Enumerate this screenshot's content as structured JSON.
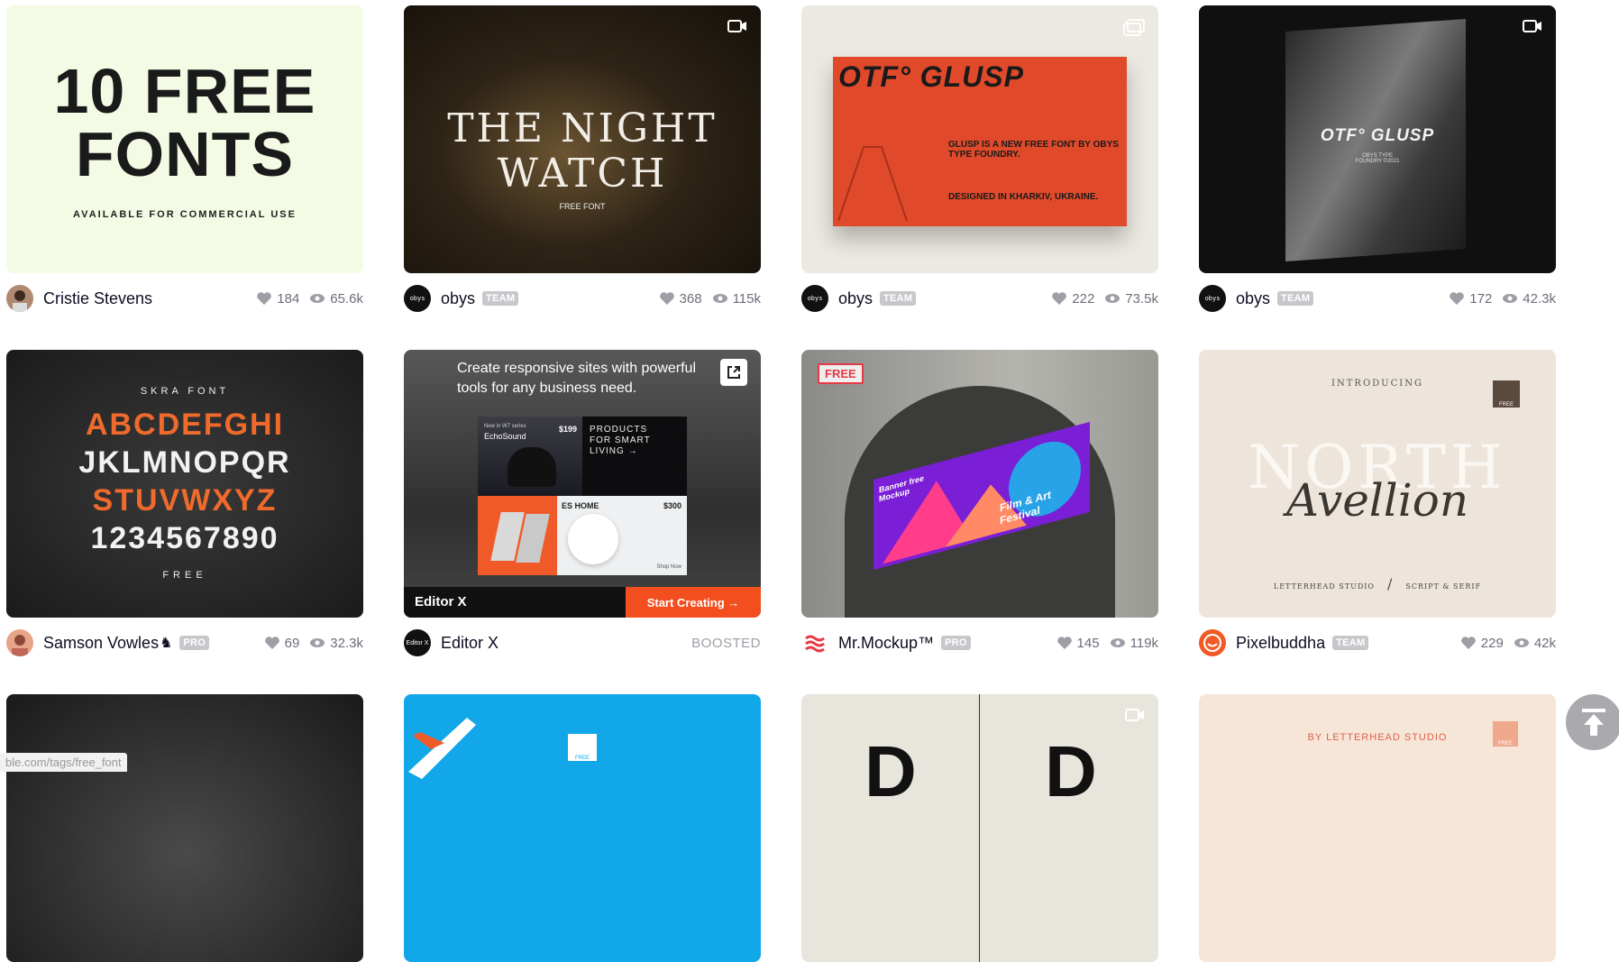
{
  "row1": [
    {
      "thumb_title_line1": "10 FREE",
      "thumb_title_line2": "FONTS",
      "thumb_sub": "AVAILABLE FOR COMMERCIAL USE",
      "author": "Cristie Stevens",
      "likes": "184",
      "views": "65.6k"
    },
    {
      "thumb_title_line1": "THE NIGHT",
      "thumb_title_line2": "WATCH",
      "thumb_sub": "FREE FONT",
      "author": "obys",
      "badge": "TEAM",
      "likes": "368",
      "views": "115k",
      "corner_icon": "video-icon"
    },
    {
      "thumb_title": "OTF° GLUSP",
      "thumb_body": "GLUSP IS A NEW FREE FONT BY OBYS TYPE FOUNDRY.",
      "thumb_body2": "DESIGNED IN KHARKIV, UKRAINE.",
      "author": "obys",
      "badge": "TEAM",
      "likes": "222",
      "views": "73.5k",
      "corner_icon": "multiple-shots-icon"
    },
    {
      "thumb_title": "OTF° GLUSP",
      "thumb_sub": "OBYS TYPE FOUNDRY ©2021",
      "author": "obys",
      "badge": "TEAM",
      "likes": "172",
      "views": "42.3k",
      "corner_icon": "video-icon"
    }
  ],
  "row2": [
    {
      "thumb_top": "SKRA FONT",
      "thumb_l1": "ABCDEFGHI",
      "thumb_l2": "JKLMNOPQR",
      "thumb_l3": "STUVWXYZ",
      "thumb_l4": "1234567890",
      "thumb_bottom": "FREE",
      "author": "Samson Vowles",
      "badge": "PRO",
      "likes": "69",
      "views": "32.3k"
    },
    {
      "ad_headline": "Create responsive sites with powerful tools for any business need.",
      "product1_small": "New in W7 series",
      "product1_name": "EchoSound",
      "product1_price": "$199",
      "product_tag": "PRODUCTS FOR SMART LIVING →",
      "shop_now": "Shop Now",
      "product2_name": "ES HOME",
      "product2_price": "$300",
      "ad_brand": "Editor X",
      "ad_cta": "Start Creating →",
      "author": "Editor X",
      "boosted": "BOOSTED",
      "avatar_text": "Editor X"
    },
    {
      "free_tag": "FREE",
      "banner_text1": "Banner free Mockup",
      "banner_text2": "Film & Art Festival",
      "author": "Mr.Mockup™",
      "badge": "PRO",
      "likes": "145",
      "views": "119k"
    },
    {
      "intro": "INTRODUCING",
      "big1": "NORTH",
      "script": "Avellion",
      "footer_l": "LETTERHEAD STUDIO",
      "footer_r": "SCRIPT & SERIF",
      "logo_text": "FREE",
      "author": "Pixelbuddha",
      "badge": "TEAM",
      "likes": "229",
      "views": "42k"
    }
  ],
  "row3": [
    {},
    {
      "logo_text": "FREE"
    },
    {
      "letter": "D"
    },
    {
      "byline": "BY LETTERHEAD STUDIO",
      "logo_text": "FREE"
    }
  ],
  "status_url": "ble.com/tags/free_font",
  "avatar_obys": "obys",
  "colors": {
    "accent": "#ea4c89",
    "ad_orange": "#f24e1e",
    "glusp_red": "#e04a2a"
  }
}
